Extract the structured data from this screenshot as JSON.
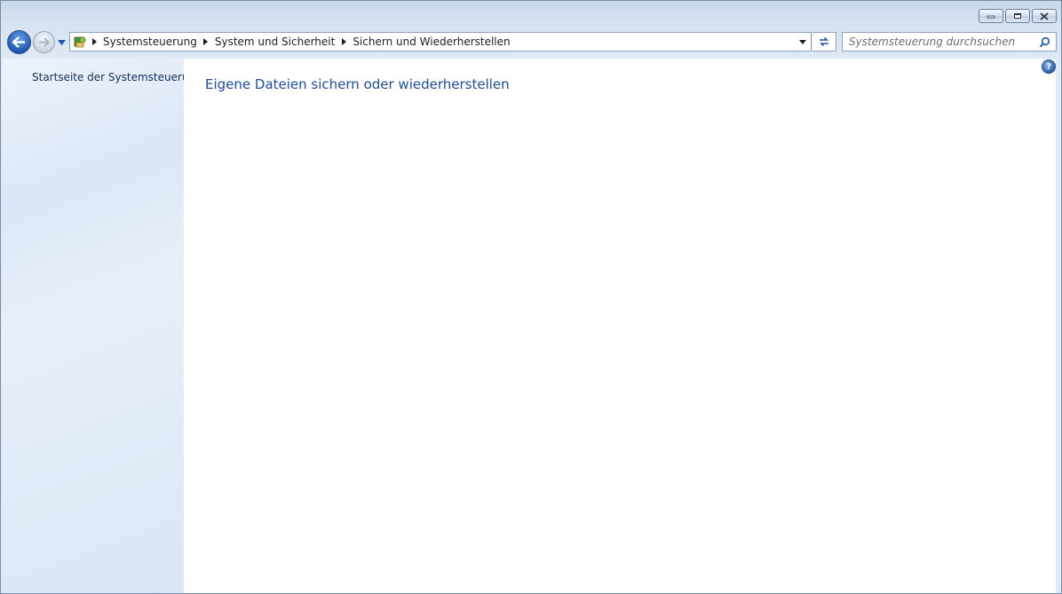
{
  "window": {
    "controls": {
      "minimize_icon": "minimize-icon",
      "maximize_icon": "restore-icon",
      "close_icon": "close-icon"
    }
  },
  "navigation": {
    "back_icon": "back-arrow-icon",
    "forward_icon": "forward-arrow-icon",
    "recent_icon": "chevron-down-icon"
  },
  "addressbar": {
    "location_icon": "control-panel-icon",
    "breadcrumbs": [
      {
        "label": "Systemsteuerung"
      },
      {
        "label": "System und Sicherheit"
      },
      {
        "label": "Sichern und Wiederherstellen"
      }
    ],
    "dropdown_icon": "chevron-down-icon",
    "refresh_icon": "refresh-icon"
  },
  "search": {
    "placeholder": "Systemsteuerung durchsuchen",
    "value": ""
  },
  "sidebar": {
    "links": [
      {
        "label": "Startseite der Systemsteuerung"
      }
    ]
  },
  "main": {
    "title": "Eigene Dateien sichern oder wiederherstellen",
    "help_label": "?"
  },
  "colors": {
    "link": "#1e4d9c",
    "sidebar_text": "#12315a",
    "accent_blue": "#1f56b3"
  }
}
